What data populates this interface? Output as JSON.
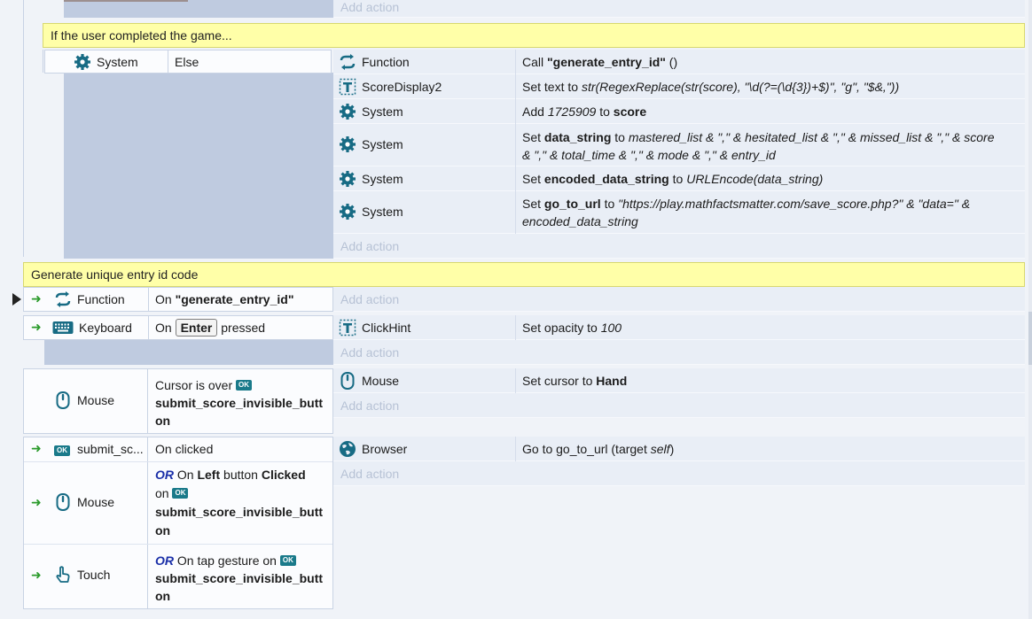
{
  "top_block": {
    "add_action": "Add action"
  },
  "else_block": {
    "comment": "If the user completed the game...",
    "condition_object": "System",
    "condition_text": "Else",
    "actions": [
      {
        "icon": "function-icon",
        "object": "Function",
        "text_pre": "Call ",
        "bold": "\"generate_entry_id\"",
        "text_post": " ()"
      },
      {
        "icon": "text-object-icon",
        "object": "ScoreDisplay2",
        "text_pre": "Set text to ",
        "italic": "str(RegexReplace(str(score), \"\\d(?=(\\d{3})+$)\", \"g\", \"$&,\"))"
      },
      {
        "icon": "system-gear-icon",
        "object": "System",
        "text_pre": "Add ",
        "italic": "1725909",
        "text_mid": " to ",
        "bold": "score"
      },
      {
        "icon": "system-gear-icon",
        "object": "System",
        "text_pre": "Set ",
        "bold": "data_string",
        "text_mid": " to ",
        "italic_line1": "mastered_list & \",\" & hesitated_list & \",\" & missed_list & \",\" & score",
        "italic_line2": "& \",\" & total_time & \",\" & mode & \",\" & entry_id"
      },
      {
        "icon": "system-gear-icon",
        "object": "System",
        "text_pre": "Set ",
        "bold": "encoded_data_string",
        "text_mid": " to ",
        "italic": "URLEncode(data_string)"
      },
      {
        "icon": "system-gear-icon",
        "object": "System",
        "text_pre": "Set ",
        "bold": "go_to_url",
        "text_mid": " to ",
        "italic_line1": "\"https://play.mathfactsmatter.com/save_score.php?\" & \"data=\" &",
        "italic_line2": "encoded_data_string"
      }
    ],
    "add_action": "Add action"
  },
  "function_block": {
    "comment": "Generate unique entry id code",
    "object": "Function",
    "text_pre": "On ",
    "bold": "\"generate_entry_id\"",
    "add_action": "Add action"
  },
  "keyboard_block": {
    "object": "Keyboard",
    "text_pre": "On ",
    "key": "Enter",
    "text_post": " pressed",
    "action_object": "ClickHint",
    "action_text": "Set opacity to ",
    "action_value": "100",
    "add_action": "Add action"
  },
  "mouse_over_block": {
    "object": "Mouse",
    "text_pre": "Cursor is over ",
    "badge": "OK",
    "bold_line1": "submit_score_invisible_butt",
    "bold_line2": "on",
    "action_object": "Mouse",
    "action_text": "Set cursor to ",
    "action_value": "Hand",
    "add_action": "Add action"
  },
  "click_block": {
    "cond1_badge": "OK",
    "cond1_object": "submit_sc...",
    "cond1_text": "On clicked",
    "cond2_object": "Mouse",
    "cond2_or": "OR",
    "cond2_text_pre": " On ",
    "cond2_bold1": "Left",
    "cond2_text_mid": " button ",
    "cond2_bold2": "Clicked",
    "cond2_on": "on ",
    "cond2_badge": "OK",
    "cond2_bold_line1": "submit_score_invisible_butt",
    "cond2_bold_line2": "on",
    "cond3_object": "Touch",
    "cond3_or": "OR",
    "cond3_text": " On tap gesture on ",
    "cond3_badge": "OK",
    "cond3_bold_line1": "submit_score_invisible_butt",
    "cond3_bold_line2": "on",
    "action_object": "Browser",
    "action_text": "Go to go_to_url (target ",
    "action_italic": "self",
    "action_post": ")",
    "add_action": "Add action"
  }
}
